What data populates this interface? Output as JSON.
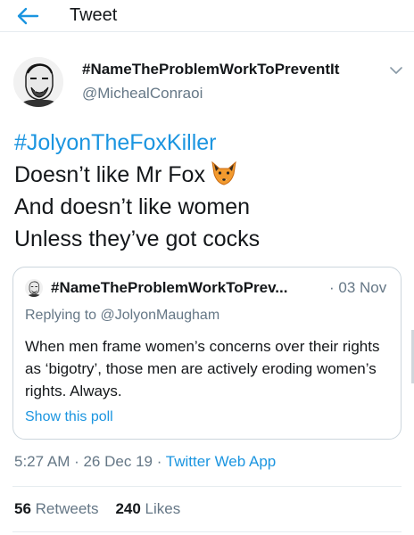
{
  "header": {
    "title": "Tweet",
    "back_icon": "back-arrow-icon"
  },
  "author": {
    "display_name": "#NameTheProblemWorkToPreventIt",
    "handle": "@MichealConraoi",
    "avatar_icon": "avatar-sketch-portrait"
  },
  "tweet": {
    "hashtag": "#JolyonTheFoxKiller",
    "line1": "Doesn’t like Mr Fox",
    "line2": "And doesn’t like women",
    "line3": "Unless they’ve got cocks",
    "emoji": "fox-face-emoji"
  },
  "quoted_tweet": {
    "display_name": "#NameTheProblemWorkToPrev...",
    "date": "· 03 Nov",
    "replying_label": "Replying to",
    "replying_to": "@JolyonMaugham",
    "text": "When men frame women’s concerns over their rights as ‘bigotry’, those men are actively eroding women’s rights. Always.",
    "poll_link": "Show this poll"
  },
  "meta": {
    "time_date": "5:27 AM · 26 Dec 19 · ",
    "source": "Twitter Web App"
  },
  "stats": {
    "retweets_count": "56",
    "retweets_label": "Retweets",
    "likes_count": "240",
    "likes_label": "Likes"
  },
  "colors": {
    "link": "#1b95e0",
    "muted": "#657786",
    "text": "#14171a",
    "border": "#e6ecf0"
  }
}
